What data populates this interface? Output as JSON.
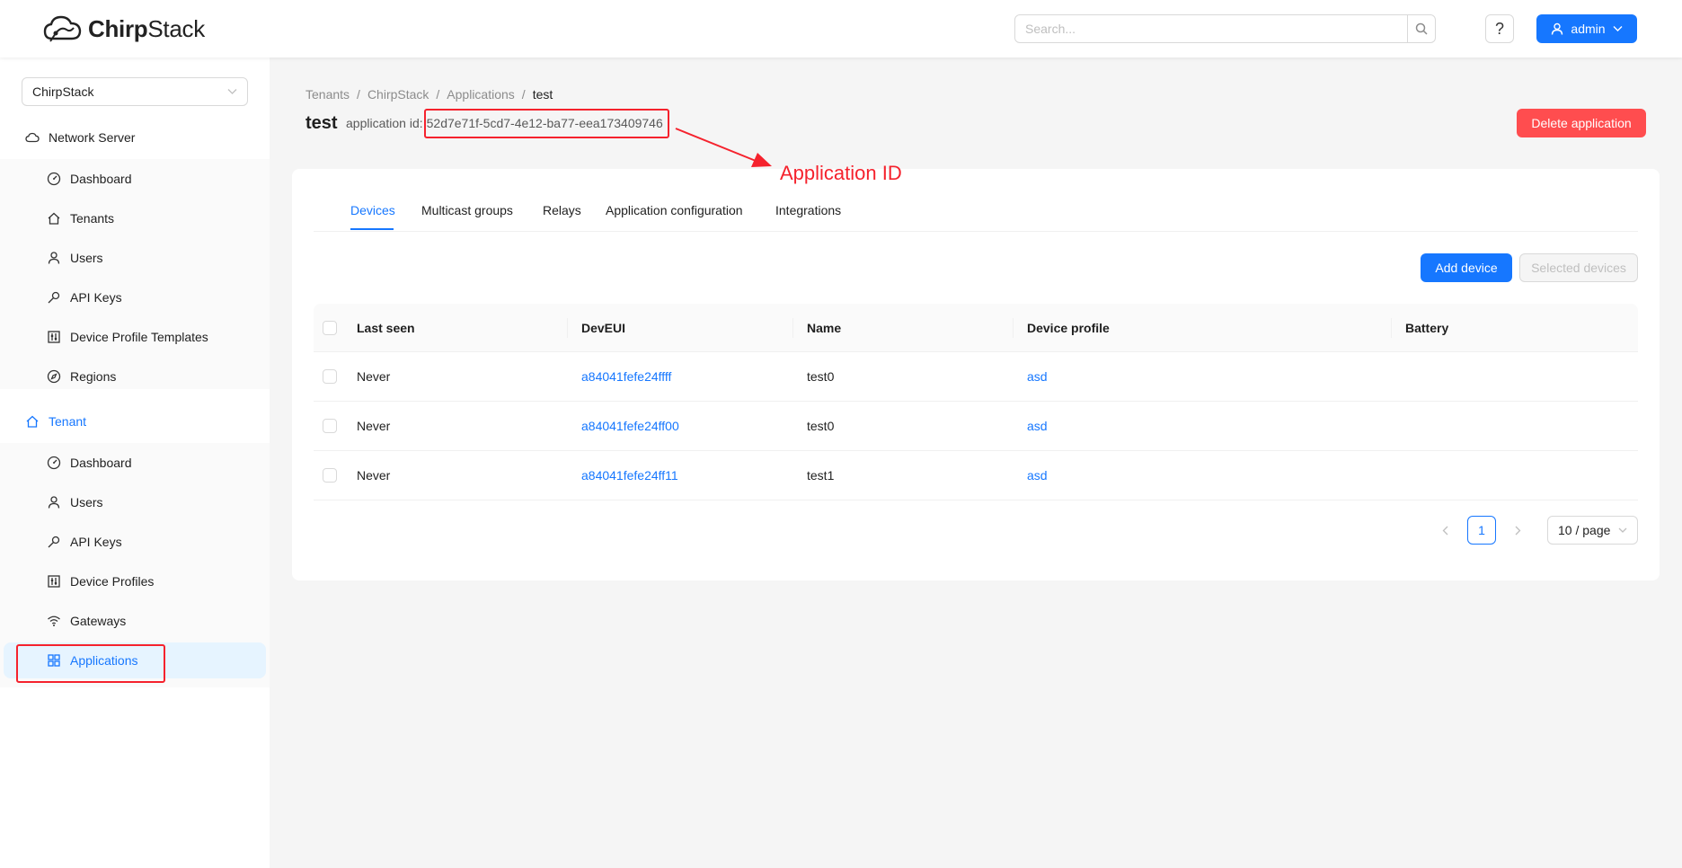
{
  "header": {
    "logo_text_bold": "Chirp",
    "logo_text_light": "Stack",
    "search_placeholder": "Search...",
    "help_label": "?",
    "user_label": "admin"
  },
  "sidebar": {
    "tenant_selector": "ChirpStack",
    "network_server": {
      "label": "Network Server",
      "items": [
        {
          "label": "Dashboard",
          "icon": "dashboard-icon"
        },
        {
          "label": "Tenants",
          "icon": "home-icon"
        },
        {
          "label": "Users",
          "icon": "user-icon"
        },
        {
          "label": "API Keys",
          "icon": "key-icon"
        },
        {
          "label": "Device Profile Templates",
          "icon": "control-icon"
        },
        {
          "label": "Regions",
          "icon": "compass-icon"
        }
      ]
    },
    "tenant": {
      "label": "Tenant",
      "items": [
        {
          "label": "Dashboard",
          "icon": "dashboard-icon"
        },
        {
          "label": "Users",
          "icon": "user-icon"
        },
        {
          "label": "API Keys",
          "icon": "key-icon"
        },
        {
          "label": "Device Profiles",
          "icon": "control-icon"
        },
        {
          "label": "Gateways",
          "icon": "wifi-icon"
        },
        {
          "label": "Applications",
          "icon": "appstore-icon"
        }
      ]
    }
  },
  "breadcrumb": [
    "Tenants",
    "ChirpStack",
    "Applications",
    "test"
  ],
  "breadcrumb_separator": "/",
  "page": {
    "title": "test",
    "app_id_label": "application id:",
    "app_id_value": "52d7e71f-5cd7-4e12-ba77-eea173409746",
    "delete_label": "Delete application"
  },
  "tabs": [
    "Devices",
    "Multicast groups",
    "Relays",
    "Application configuration",
    "Integrations"
  ],
  "actions": {
    "add_device": "Add device",
    "selected_devices": "Selected devices"
  },
  "table": {
    "columns": [
      "Last seen",
      "DevEUI",
      "Name",
      "Device profile",
      "Battery"
    ],
    "rows": [
      {
        "last_seen": "Never",
        "dev_eui": "a84041fefe24ffff",
        "name": "test0",
        "device_profile": "asd",
        "battery": ""
      },
      {
        "last_seen": "Never",
        "dev_eui": "a84041fefe24ff00",
        "name": "test0",
        "device_profile": "asd",
        "battery": ""
      },
      {
        "last_seen": "Never",
        "dev_eui": "a84041fefe24ff11",
        "name": "test1",
        "device_profile": "asd",
        "battery": ""
      }
    ]
  },
  "pagination": {
    "current_page": "1",
    "page_size": "10 / page"
  },
  "annotation": {
    "label": "Application ID",
    "color": "#f5222d"
  },
  "colors": {
    "primary": "#1677ff",
    "danger": "#ff4d4f"
  }
}
